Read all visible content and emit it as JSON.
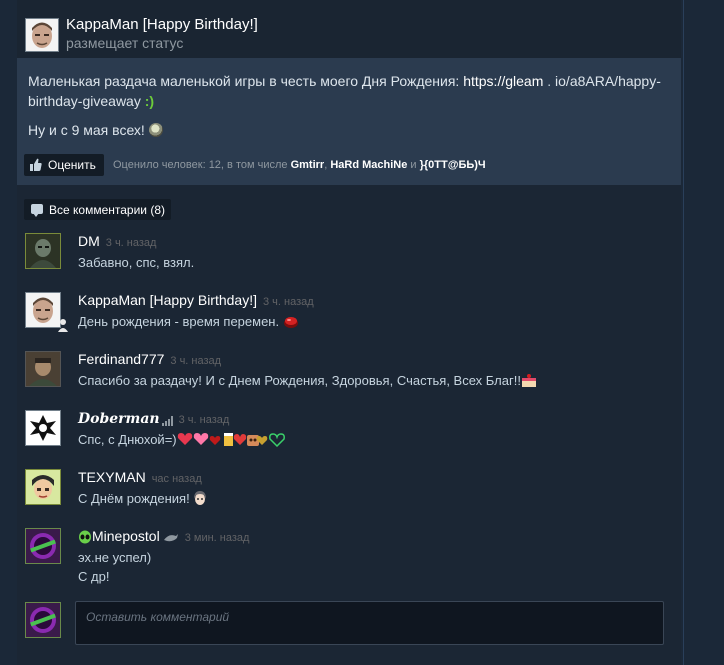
{
  "post": {
    "author": "KappaMan [Happy Birthday!]",
    "action": "размещает статус",
    "text_before_link": "Маленькая раздача маленькой игры в честь моего Дня Рождения: ",
    "link_main": "https://gleam",
    "link_sep": " . ",
    "link_rest": "io/a8ARA/happy-birthday-giveaway",
    "text_emote": ":)",
    "line2": "Ну и с 9 мая всех!",
    "rate_button": "Оценить",
    "rated_prefix": "Оценило человек: 12, в том числе ",
    "rated_user1": "Gmtirr",
    "rated_sep1": ", ",
    "rated_user2": "HaRd MachiNe",
    "rated_sep2": " и ",
    "rated_user3": "}{0TT@БЬ)Ч"
  },
  "all_comments_label": "Все комментарии (8)",
  "comments": [
    {
      "author": "DM",
      "time": "3 ч. назад",
      "lines": [
        "Забавно, спс, взял."
      ]
    },
    {
      "author": "KappaMan [Happy Birthday!]",
      "time": "3 ч. назад",
      "lines": [
        "День рождения - время перемен."
      ]
    },
    {
      "author": "Ferdinand777",
      "time": "3 ч. назад",
      "lines": [
        "Спасибо за раздачу! И с Днем Рождения, Здоровья, Счастья, Всех Благ!!"
      ]
    },
    {
      "author": "Doberman",
      "time": "3 ч. назад",
      "lines": [
        "Спс, с Днюхой=)"
      ]
    },
    {
      "author": "TEXYMAN",
      "time": "час назад",
      "lines": [
        "С Днём рождения!"
      ]
    },
    {
      "author": "Minepostol",
      "time": "3 мин. назад",
      "lines": [
        "эх.не успел)",
        "С др!"
      ]
    }
  ],
  "comment_input": {
    "placeholder": "Оставить комментарий"
  },
  "colors": {
    "background": "#1b2838",
    "card": "#2b3b4f",
    "link": "#ffffff",
    "time": "#626366"
  }
}
